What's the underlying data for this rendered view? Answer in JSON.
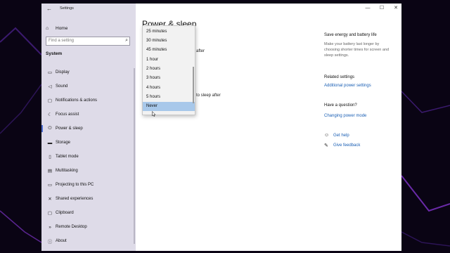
{
  "window": {
    "title": "Settings",
    "controls": {
      "minimize": "—",
      "maximize": "☐",
      "close": "✕"
    }
  },
  "sidebar": {
    "home_label": "Home",
    "search": {
      "placeholder": "Find a setting"
    },
    "section": "System",
    "items": [
      {
        "label": "Display",
        "icon": "display-icon",
        "glyph": "▭"
      },
      {
        "label": "Sound",
        "icon": "speaker-icon",
        "glyph": "◁"
      },
      {
        "label": "Notifications & actions",
        "icon": "notifications-icon",
        "glyph": "▢"
      },
      {
        "label": "Focus assist",
        "icon": "moon-icon",
        "glyph": "☾"
      },
      {
        "label": "Power & sleep",
        "icon": "power-icon",
        "glyph": "⏻",
        "active": true
      },
      {
        "label": "Storage",
        "icon": "storage-icon",
        "glyph": "▬"
      },
      {
        "label": "Tablet mode",
        "icon": "tablet-icon",
        "glyph": "▯"
      },
      {
        "label": "Multitasking",
        "icon": "multitasking-icon",
        "glyph": "▤"
      },
      {
        "label": "Projecting to this PC",
        "icon": "projecting-icon",
        "glyph": "▭"
      },
      {
        "label": "Shared experiences",
        "icon": "shared-icon",
        "glyph": "✕"
      },
      {
        "label": "Clipboard",
        "icon": "clipboard-icon",
        "glyph": "▢"
      },
      {
        "label": "Remote Desktop",
        "icon": "remote-desktop-icon",
        "glyph": "»"
      },
      {
        "label": "About",
        "icon": "info-icon",
        "glyph": "ⓘ"
      }
    ]
  },
  "main": {
    "title_fragment": "Power & sleep",
    "fragment_after": "after",
    "fragment_sleep": "to sleep after"
  },
  "dropdown": {
    "options": [
      "25 minutes",
      "30 minutes",
      "45 minutes",
      "1 hour",
      "2 hours",
      "3 hours",
      "4 hours",
      "5 hours",
      "Never"
    ],
    "selected": "Never"
  },
  "related": {
    "save_heading": "Save energy and battery life",
    "save_text": "Make your battery last longer by choosing shorter times for screen and sleep settings.",
    "related_heading": "Related settings",
    "related_link": "Additional power settings",
    "question_heading": "Have a question?",
    "question_link": "Changing power mode",
    "help_link": "Get help",
    "feedback_link": "Give feedback"
  }
}
